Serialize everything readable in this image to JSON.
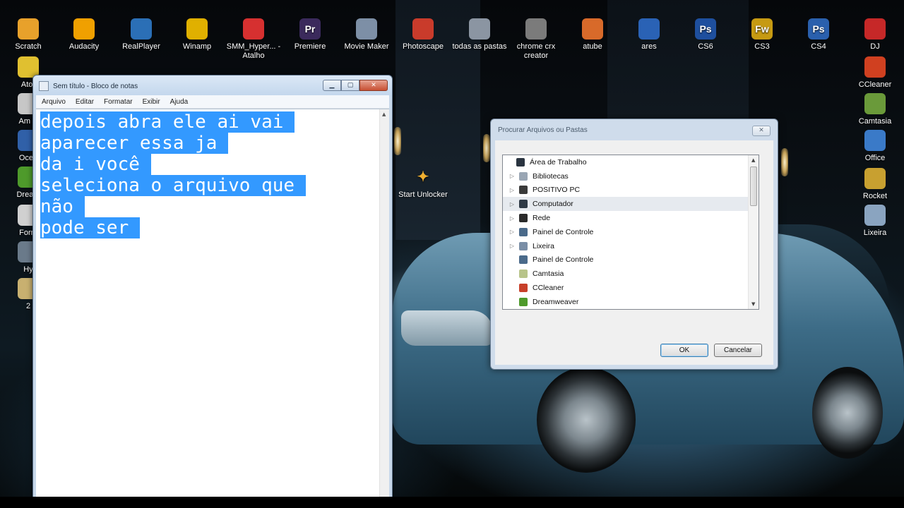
{
  "desktop": {
    "top_icons": [
      {
        "label": "Scratch",
        "icon": "cat-icon",
        "color": "#e8a12b"
      },
      {
        "label": "Audacity",
        "icon": "headphones-icon",
        "color": "#f0a000"
      },
      {
        "label": "RealPlayer",
        "icon": "realplayer-icon",
        "color": "#2b6fb6"
      },
      {
        "label": "Winamp",
        "icon": "lightning-icon",
        "color": "#e0b000"
      },
      {
        "label": "SMM_Hyper... - Atalho",
        "icon": "record-icon",
        "color": "#d63030"
      },
      {
        "label": "Premiere",
        "icon": "premiere-icon",
        "color": "#3b2a5c",
        "glyph": "Pr"
      },
      {
        "label": "Movie Maker",
        "icon": "film-icon",
        "color": "#7d8fa6"
      },
      {
        "label": "Photoscape",
        "icon": "photoscape-icon",
        "color": "#c93b2b"
      },
      {
        "label": "todas as pastas",
        "icon": "folder-icon",
        "color": "#8b95a2"
      },
      {
        "label": "chrome crx creator",
        "icon": "chrome-icon",
        "color": "#7b7b7b"
      },
      {
        "label": "atube",
        "icon": "atube-icon",
        "color": "#d86a2a"
      },
      {
        "label": "ares",
        "icon": "ares-icon",
        "color": "#2a62b5"
      },
      {
        "label": "CS6",
        "icon": "photoshop-icon",
        "color": "#1e4f9e",
        "glyph": "Ps"
      },
      {
        "label": "CS3",
        "icon": "fireworks-icon",
        "color": "#c69a12",
        "glyph": "Fw"
      },
      {
        "label": "CS4",
        "icon": "photoshop-icon",
        "color": "#2a60ad",
        "glyph": "Ps"
      },
      {
        "label": "DJ",
        "icon": "dj-icon",
        "color": "#c62828"
      }
    ],
    "left_icons": [
      {
        "label": "Ator",
        "icon": "atom-icon",
        "color": "#e0c030"
      },
      {
        "label": "Am V",
        "icon": "program-icon",
        "color": "#c7c7c7"
      },
      {
        "label": "Ocea",
        "icon": "ocean-icon",
        "color": "#3060a8"
      },
      {
        "label": "Dream",
        "icon": "dreamweaver-icon",
        "color": "#4e9a2b"
      },
      {
        "label": "Form",
        "icon": "format-icon",
        "color": "#d0d0d0"
      },
      {
        "label": "Hy",
        "icon": "hyper-icon",
        "color": "#6a7a8a"
      },
      {
        "label": "2",
        "icon": "shortcut-icon",
        "color": "#c8b070"
      }
    ],
    "right_icons": [
      {
        "label": "CCleaner",
        "icon": "ccleaner-icon",
        "color": "#d04020"
      },
      {
        "label": "Camtasia",
        "icon": "camtasia-icon",
        "color": "#6a9a3a"
      },
      {
        "label": "Office",
        "icon": "office-icon",
        "color": "#3a7ac8"
      },
      {
        "label": "Rocket",
        "icon": "rocket-icon",
        "color": "#c8a030"
      },
      {
        "label": "Lixeira",
        "icon": "recycle-bin-icon",
        "color": "#8aa4c0"
      }
    ],
    "middle_icon": {
      "label": "Start Unlocker",
      "icon": "unlocker-icon",
      "color": "#e0a030"
    }
  },
  "notepad": {
    "title": "Sem título - Bloco de notas",
    "menus": [
      "Arquivo",
      "Editar",
      "Formatar",
      "Exibir",
      "Ajuda"
    ],
    "lines": [
      "depois abra ele ai vai",
      "aparecer essa ja",
      "da i você",
      "seleciona o arquivo que",
      "não",
      "pode ser"
    ],
    "selection_color": "#3399ff"
  },
  "dialog": {
    "title": "Procurar Arquivos ou Pastas",
    "tree": [
      {
        "label": "Área de Trabalho",
        "level": 0,
        "expander": "",
        "icon": "desktop-icon",
        "color": "#2a3440"
      },
      {
        "label": "Bibliotecas",
        "level": 1,
        "expander": "▷",
        "icon": "library-icon",
        "color": "#9aa6b4"
      },
      {
        "label": "POSITIVO PC",
        "level": 1,
        "expander": "▷",
        "icon": "user-folder-icon",
        "color": "#3a3a3a"
      },
      {
        "label": "Computador",
        "level": 1,
        "expander": "▷",
        "icon": "computer-icon",
        "color": "#2e3a46",
        "selected": true
      },
      {
        "label": "Rede",
        "level": 1,
        "expander": "▷",
        "icon": "network-icon",
        "color": "#2a2a2a"
      },
      {
        "label": "Painel de Controle",
        "level": 1,
        "expander": "▷",
        "icon": "control-panel-icon",
        "color": "#4a6a8a"
      },
      {
        "label": "Lixeira",
        "level": 1,
        "expander": "▷",
        "icon": "recycle-bin-icon",
        "color": "#7a8ea6"
      },
      {
        "label": "Painel de Controle",
        "level": 1,
        "expander": "",
        "icon": "control-panel-icon",
        "color": "#4a6a8a"
      },
      {
        "label": "Camtasia",
        "level": 1,
        "expander": "",
        "icon": "camtasia-icon",
        "color": "#b8c48a"
      },
      {
        "label": "CCleaner",
        "level": 1,
        "expander": "",
        "icon": "ccleaner-icon",
        "color": "#c8402a"
      },
      {
        "label": "Dreamweaver",
        "level": 1,
        "expander": "",
        "icon": "dreamweaver-icon",
        "color": "#4e9a2b"
      }
    ],
    "ok_label": "OK",
    "cancel_label": "Cancelar"
  }
}
